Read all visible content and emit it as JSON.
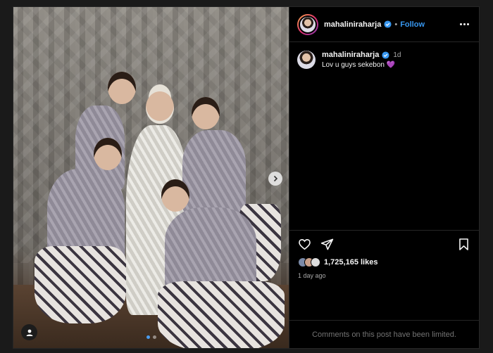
{
  "post": {
    "username": "mahaliniraharja",
    "follow_label": "Follow",
    "separator": "•",
    "caption": {
      "username": "mahaliniraharja",
      "time": "1d",
      "text": "Lov u guys sekebon 💜"
    },
    "likes": "1,725,165 likes",
    "posted_ago": "1 day ago",
    "comments_limited": "Comments on this post have been limited.",
    "carousel": {
      "total": 2,
      "active": 1
    }
  },
  "colors": {
    "accent": "#3797f0",
    "background": "#000000",
    "page": "#1a1a1a",
    "border": "#262626",
    "muted": "#a8a8a8"
  },
  "icons": [
    "chevron-right-icon",
    "person-tag-icon",
    "verified-icon",
    "more-icon",
    "heart-icon",
    "share-icon",
    "bookmark-icon"
  ]
}
